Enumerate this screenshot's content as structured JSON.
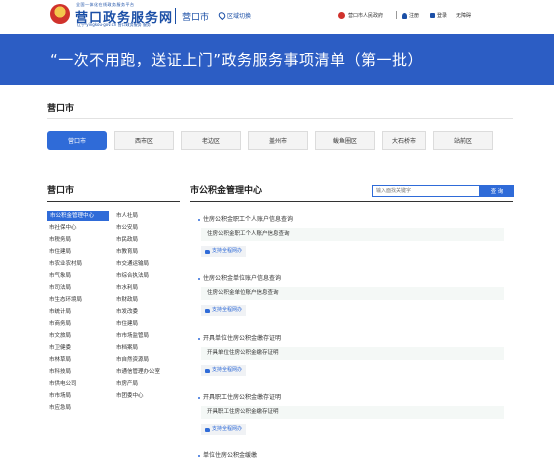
{
  "header": {
    "logo_top": "全国一体化在线政务服务平台",
    "logo_main": "营口政务服务网",
    "logo_sub": "辽宁·yingkou·gov.cn  营口政务服务 服务",
    "city": "营口市",
    "region_switch": "区域切换",
    "gov_link": "营口市人民政府",
    "register": "注册",
    "login": "登录",
    "accessibility": "无障碍"
  },
  "banner": {
    "title": "“一次不用跑，送证上门”政务服务事项清单（第一批）"
  },
  "city_section": {
    "title": "营口市",
    "tabs": [
      "营口市",
      "西市区",
      "老边区",
      "盖州市",
      "鲅鱼圈区",
      "大石桥市",
      "站前区"
    ],
    "active_tab": 0
  },
  "left": {
    "title": "营口市",
    "departments": [
      "市公积金管理中心",
      "市人社局",
      "市社保中心",
      "市公安局",
      "市税务局",
      "市民政局",
      "市住建局",
      "市教育局",
      "市农业农村局",
      "市交通运输局",
      "市气象局",
      "市综合执法局",
      "市司法局",
      "市水利局",
      "市生态环境局",
      "市财政局",
      "市统计局",
      "市发改委",
      "市商务局",
      "市住建局",
      "市文旅局",
      "市市场监管局",
      "市卫健委",
      "市档案局",
      "市林草局",
      "市自然资源局",
      "市科技局",
      "市通信管理办公室",
      "市供电公司",
      "市房产局",
      "市市场局",
      "市团委中心",
      "市应急局"
    ],
    "active_department": 0
  },
  "right": {
    "title": "市公积金管理中心",
    "search_placeholder": "输入面找关键字",
    "search_button": "查 询",
    "items": [
      {
        "title": "住房公积金职工个人账户信息查询",
        "sub": "住房公积金职工个人账户信息查询",
        "badge": "支持全程网办"
      },
      {
        "title": "住房公积金单位账户信息查询",
        "sub": "住房公积金单位账户信息查询",
        "badge": "支持全程网办"
      },
      {
        "title": "开具单位住房公积金缴存证明",
        "sub": "开具单位住房公积金缴存证明",
        "badge": "支持全程网办"
      },
      {
        "title": "开具职工住房公积金缴存证明",
        "sub": "开具职工住房公积金缴存证明",
        "badge": "支持全程网办"
      },
      {
        "title": "单位住房公积金缓缴"
      }
    ]
  },
  "colors": {
    "primary": "#2f6bd8",
    "banner": "#2c5dc4",
    "brand": "#1b4fa6"
  }
}
